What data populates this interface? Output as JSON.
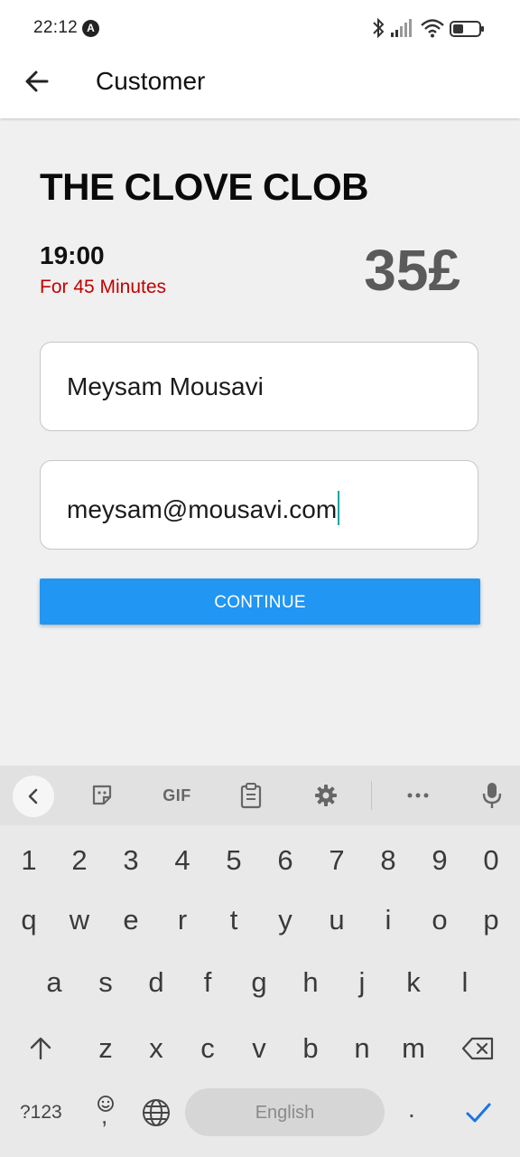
{
  "status_bar": {
    "time": "22:12",
    "badge": "A"
  },
  "app_bar": {
    "title": "Customer"
  },
  "booking": {
    "venue": "THE CLOVE CLOB",
    "time": "19:00",
    "duration": "For 45 Minutes",
    "price": "35£"
  },
  "form": {
    "name_value": "Meysam Mousavi",
    "email_value": "meysam@mousavi.com",
    "continue_label": "CONTINUE"
  },
  "keyboard": {
    "toolbar": {
      "gif_label": "GIF"
    },
    "rows": {
      "numbers": [
        "1",
        "2",
        "3",
        "4",
        "5",
        "6",
        "7",
        "8",
        "9",
        "0"
      ],
      "row1": [
        "q",
        "w",
        "e",
        "r",
        "t",
        "y",
        "u",
        "i",
        "o",
        "p"
      ],
      "row2": [
        "a",
        "s",
        "d",
        "f",
        "g",
        "h",
        "j",
        "k",
        "l"
      ],
      "row3": [
        "z",
        "x",
        "c",
        "v",
        "b",
        "n",
        "m"
      ]
    },
    "symbols_label": "?123",
    "comma_label": ",",
    "space_label": "English",
    "period_label": "."
  },
  "colors": {
    "accent": "#2196f3",
    "duration_text": "#c40000",
    "price_text": "#5a5a5a",
    "cursor": "#0ea5a0"
  }
}
